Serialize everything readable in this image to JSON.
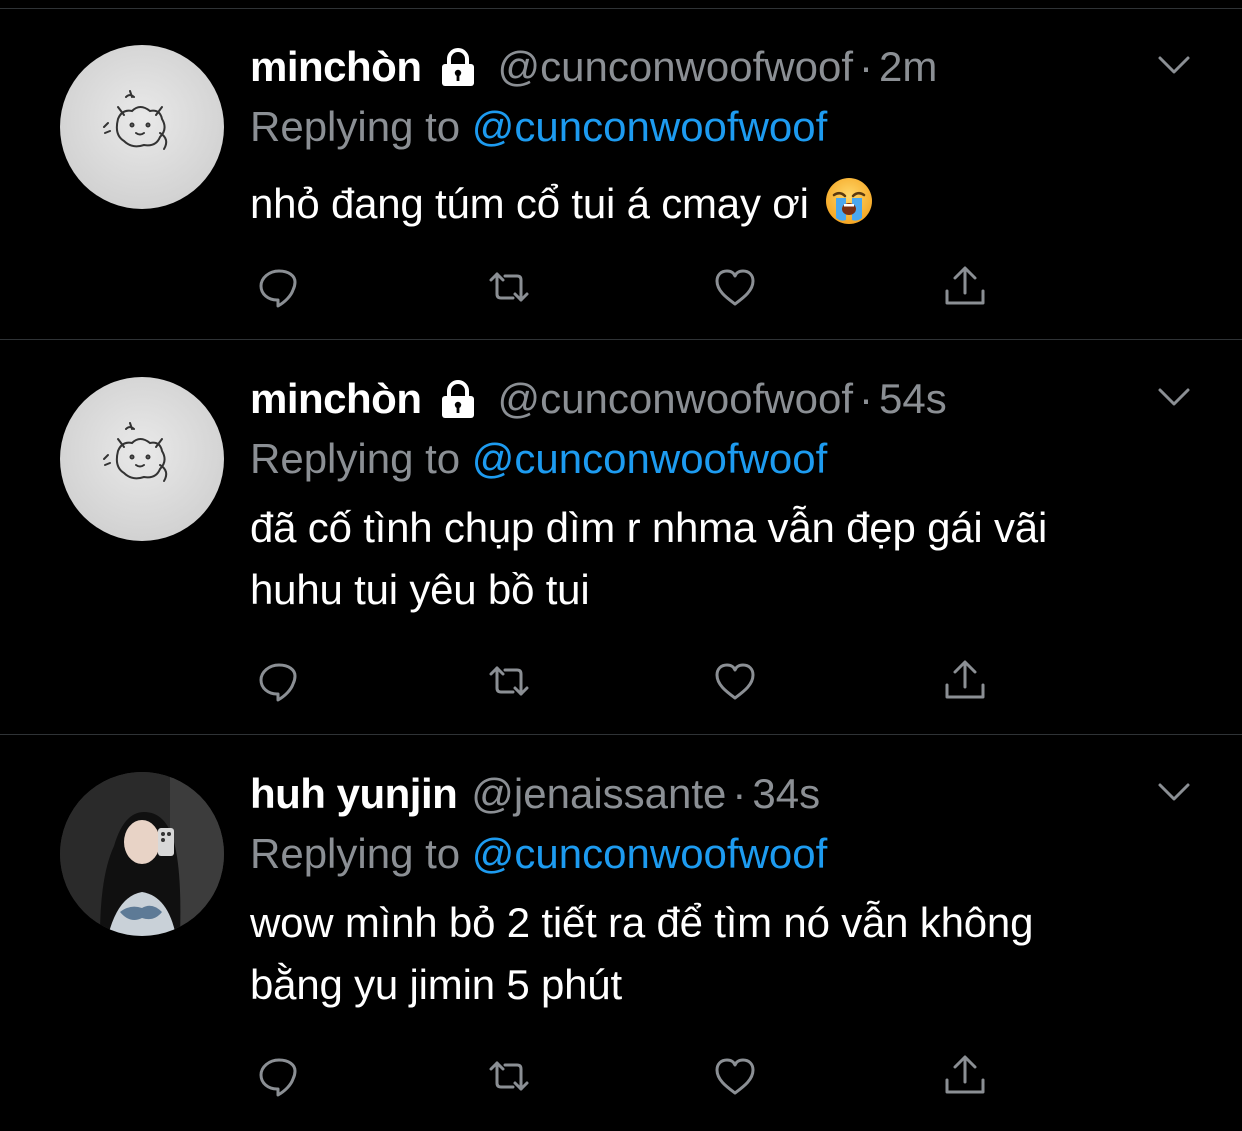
{
  "colors": {
    "background": "#000000",
    "divider": "#2f3336",
    "name": "#ffffff",
    "secondary": "#8b8f94",
    "link": "#1d9bf0"
  },
  "tweets": [
    {
      "display_name": "minchòn",
      "handle": "@cunconwoofwoof",
      "time": "2m",
      "protected": true,
      "avatar": "sketch-avatar",
      "reply_prefix": "Replying to",
      "reply_to": "@cunconwoofwoof",
      "text": "nhỏ đang túm cổ tui á cmay ơi",
      "emoji": "loudly-crying-face"
    },
    {
      "display_name": "minchòn",
      "handle": "@cunconwoofwoof",
      "time": "54s",
      "protected": true,
      "avatar": "sketch-avatar",
      "reply_prefix": "Replying to",
      "reply_to": "@cunconwoofwoof",
      "text_lines": [
        "đã cố tình chụp dìm r nhma vẫn đẹp gái vãi",
        "huhu tui yêu bồ tui"
      ]
    },
    {
      "display_name": "huh yunjin",
      "handle": "@jenaissante",
      "time": "34s",
      "protected": false,
      "avatar": "photo-avatar",
      "reply_prefix": "Replying to",
      "reply_to": "@cunconwoofwoof",
      "text_lines": [
        "wow mình bỏ 2 tiết ra để tìm nó vẫn không",
        "bằng yu jimin 5 phút"
      ]
    }
  ],
  "sep": "·",
  "icons": [
    "reply-icon",
    "retweet-icon",
    "like-icon",
    "share-icon",
    "lock-icon",
    "chevron-down-icon"
  ]
}
